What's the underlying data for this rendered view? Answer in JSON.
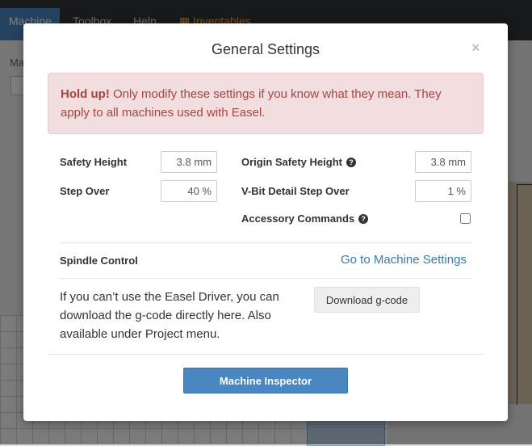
{
  "background": {
    "nav_tabs": [
      "Machine",
      "Toolbox",
      "Help",
      "Inventables"
    ],
    "left_label": "Ma"
  },
  "modal": {
    "title": "General Settings",
    "close_glyph": "×",
    "alert": {
      "emphasis": "Hold up!",
      "message": " Only modify these settings if you know what they mean. They apply to all machines used with Easel."
    },
    "fields": {
      "safety_height": {
        "label": "Safety Height",
        "value": "3.8 mm"
      },
      "step_over": {
        "label": "Step Over",
        "value": "40 %"
      },
      "origin_safety_height": {
        "label": "Origin Safety Height",
        "value": "3.8 mm"
      },
      "vbit_detail_step_over": {
        "label": "V-Bit Detail Step Over",
        "value": "1 %"
      },
      "accessory_commands": {
        "label": "Accessory Commands",
        "checked": false
      }
    },
    "spindle": {
      "label": "Spindle Control",
      "link": "Go to Machine Settings"
    },
    "download": {
      "description": "If you can’t use the Easel Driver, you can download the g-code directly here. Also available under Project menu.",
      "button": "Download g-code"
    },
    "inspector_button": "Machine Inspector"
  },
  "colors": {
    "primary": "#4a87c0",
    "alert_bg": "#f2dede",
    "alert_text": "#a94442",
    "link": "#337ab7"
  }
}
